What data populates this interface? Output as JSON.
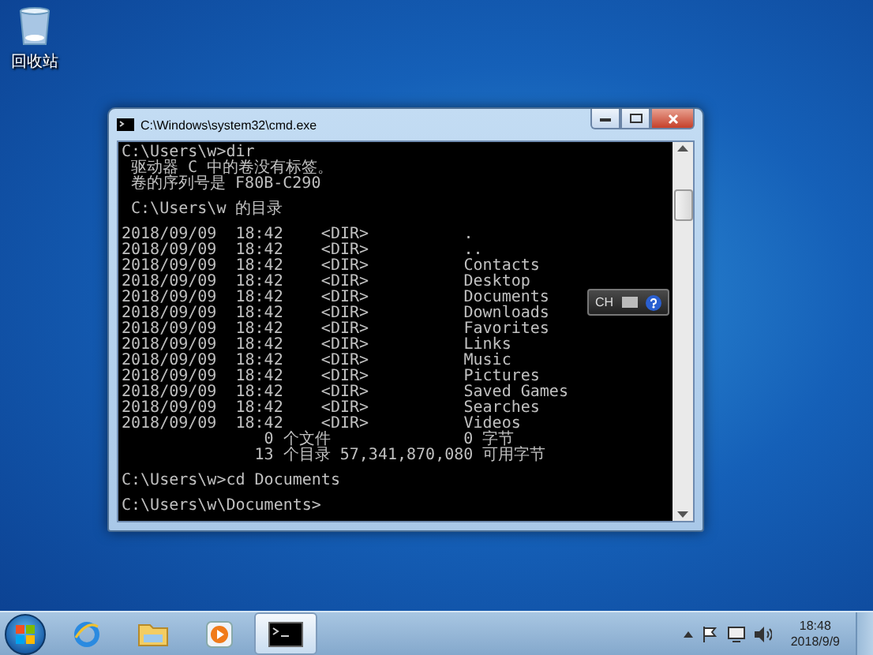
{
  "desktop_icons": [
    {
      "label": "回收站"
    }
  ],
  "window": {
    "title": "C:\\Windows\\system32\\cmd.exe",
    "console_blocks": [
      [
        "C:\\Users\\w>dir",
        " 驱动器 C 中的卷没有标签。",
        " 卷的序列号是 F80B-C290"
      ],
      [
        " C:\\Users\\w 的目录"
      ],
      [
        "2018/09/09  18:42    <DIR>          .",
        "2018/09/09  18:42    <DIR>          ..",
        "2018/09/09  18:42    <DIR>          Contacts",
        "2018/09/09  18:42    <DIR>          Desktop",
        "2018/09/09  18:42    <DIR>          Documents",
        "2018/09/09  18:42    <DIR>          Downloads",
        "2018/09/09  18:42    <DIR>          Favorites",
        "2018/09/09  18:42    <DIR>          Links",
        "2018/09/09  18:42    <DIR>          Music",
        "2018/09/09  18:42    <DIR>          Pictures",
        "2018/09/09  18:42    <DIR>          Saved Games",
        "2018/09/09  18:42    <DIR>          Searches",
        "2018/09/09  18:42    <DIR>          Videos",
        "               0 个文件              0 字节",
        "              13 个目录 57,341,870,080 可用字节"
      ],
      [
        "C:\\Users\\w>cd Documents"
      ],
      [
        "C:\\Users\\w\\Documents>"
      ]
    ]
  },
  "language_bar": {
    "label": "CH"
  },
  "taskbar": {
    "apps": [
      {
        "kind": "browser",
        "selected": false
      },
      {
        "kind": "folder",
        "selected": false
      },
      {
        "kind": "media",
        "selected": false
      },
      {
        "kind": "console",
        "selected": true
      }
    ],
    "clock": {
      "time": "18:48",
      "date": "2018/9/9"
    }
  }
}
